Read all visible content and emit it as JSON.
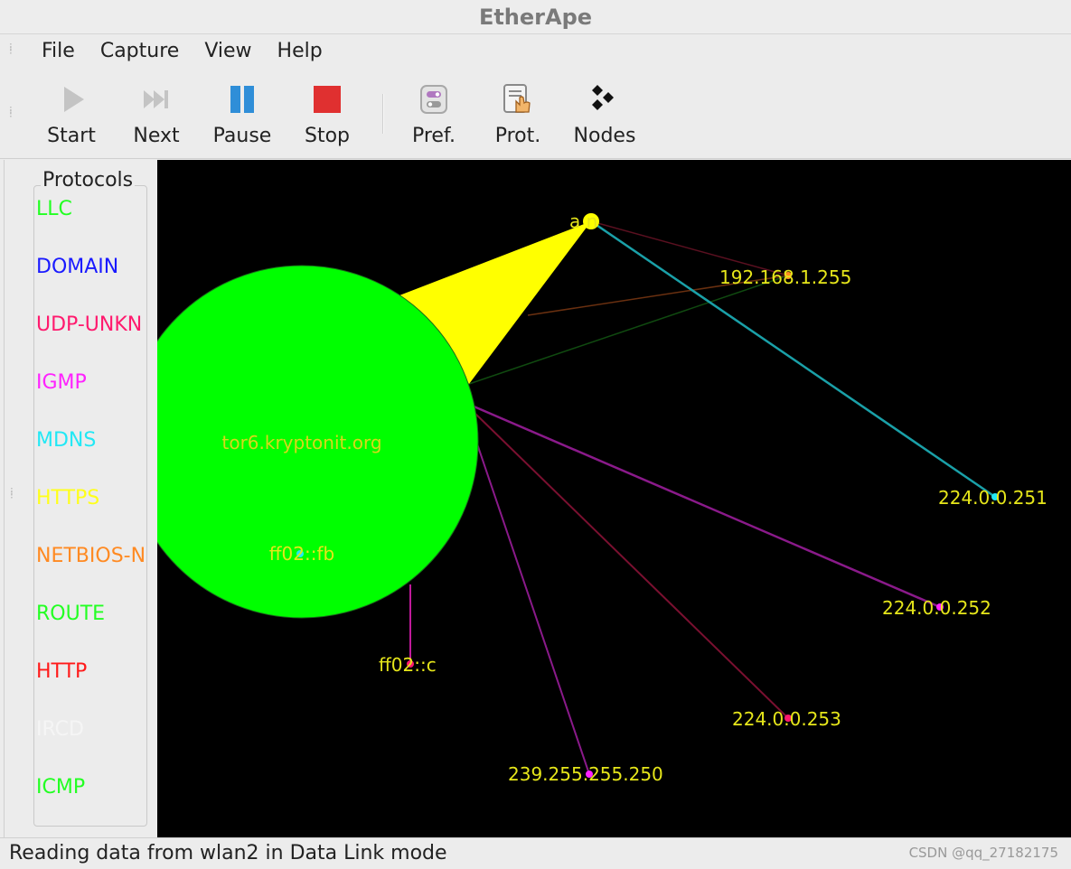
{
  "window": {
    "title": "EtherApe"
  },
  "menu": {
    "items": [
      "File",
      "Capture",
      "View",
      "Help"
    ]
  },
  "toolbar": {
    "start": "Start",
    "next": "Next",
    "pause": "Pause",
    "stop": "Stop",
    "pref": "Pref.",
    "prot": "Prot.",
    "nodes": "Nodes"
  },
  "protocols": {
    "title": "Protocols",
    "items": [
      {
        "label": "LLC",
        "color": "#22ff22"
      },
      {
        "label": "DOMAIN",
        "color": "#1a1aff"
      },
      {
        "label": "UDP-UNKN",
        "color": "#ff1a6e"
      },
      {
        "label": "IGMP",
        "color": "#ff22ff"
      },
      {
        "label": "MDNS",
        "color": "#22e8f5"
      },
      {
        "label": "HTTPS",
        "color": "#ffff1a"
      },
      {
        "label": "NETBIOS-N",
        "color": "#ff8a22"
      },
      {
        "label": "ROUTE",
        "color": "#22ff22"
      },
      {
        "label": "HTTP",
        "color": "#ff1a1a"
      },
      {
        "label": "IRCD",
        "color": "#f5f5f5"
      },
      {
        "label": "ICMP",
        "color": "#22ff22"
      }
    ]
  },
  "graph": {
    "nodes": [
      {
        "id": "aron",
        "label": "a  n",
        "hub": true
      },
      {
        "id": "bcast",
        "label": "192.168.1.255"
      },
      {
        "id": "tor",
        "label": "tor6.kryptonit.org",
        "big": true
      },
      {
        "id": "fb",
        "label": "ff02::fb"
      },
      {
        "id": "ffc",
        "label": "ff02::c"
      },
      {
        "id": "m251",
        "label": "224.0.0.251"
      },
      {
        "id": "m252",
        "label": "224.0.0.252"
      },
      {
        "id": "m253",
        "label": "224.0.0.253"
      },
      {
        "id": "ssdp",
        "label": "239.255.255.250"
      }
    ],
    "colors": {
      "big_node": "#00ff00",
      "https_link": "#ffff00",
      "mdns_link": "#1aa0a8",
      "udp_link": "#8a1a8a",
      "red_link": "#7a1030",
      "pink_link": "#c01a9a",
      "node_label": "#e6e61a"
    }
  },
  "status": {
    "text": "Reading data from wlan2 in Data Link mode",
    "watermark": "CSDN @qq_27182175"
  },
  "icons": [
    "play-icon",
    "next-icon",
    "pause-icon",
    "stop-icon",
    "preferences-icon",
    "protocols-icon",
    "nodes-icon"
  ]
}
